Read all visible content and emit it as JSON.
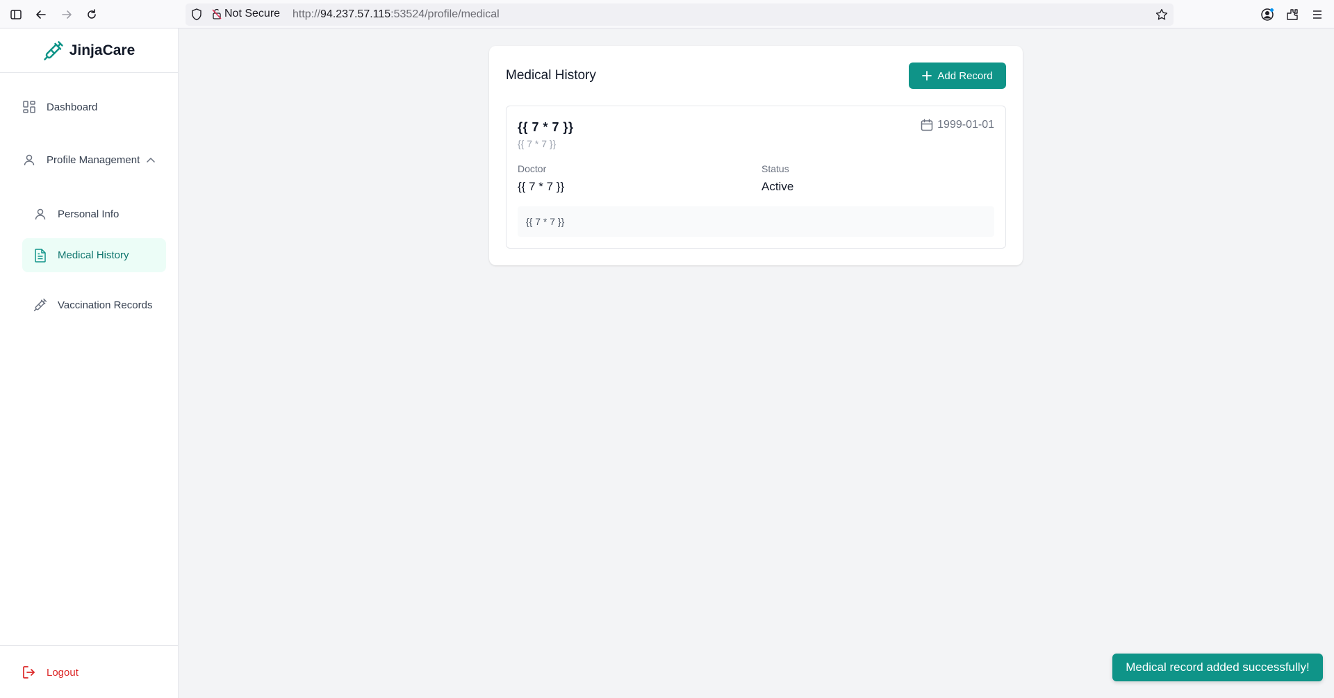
{
  "browser": {
    "security_label": "Not Secure",
    "url_scheme": "http://",
    "url_host": "94.237.57.115",
    "url_rest": ":53524/profile/medical"
  },
  "sidebar": {
    "brand": "JinjaCare",
    "items": [
      {
        "label": "Dashboard",
        "icon": "grid-icon"
      },
      {
        "label": "Profile Management",
        "icon": "user-icon"
      },
      {
        "label": "Personal Info",
        "icon": "user-icon"
      },
      {
        "label": "Medical History",
        "icon": "document-icon",
        "active": true
      },
      {
        "label": "Vaccination Records",
        "icon": "syringe-icon"
      }
    ],
    "logout_label": "Logout"
  },
  "main": {
    "title": "Medical History",
    "add_button": "Add Record",
    "record": {
      "title": "{{ 7 * 7 }}",
      "subtitle": "{{ 7 * 7 }}",
      "date": "1999-01-01",
      "doctor_label": "Doctor",
      "doctor_value": "{{ 7 * 7 }}",
      "status_label": "Status",
      "status_value": "Active",
      "notes": "{{ 7 * 7 }}"
    }
  },
  "toast": "Medical record added successfully!",
  "colors": {
    "accent": "#0f9488",
    "active_bg": "#ecfdf7",
    "danger": "#dc2626"
  }
}
